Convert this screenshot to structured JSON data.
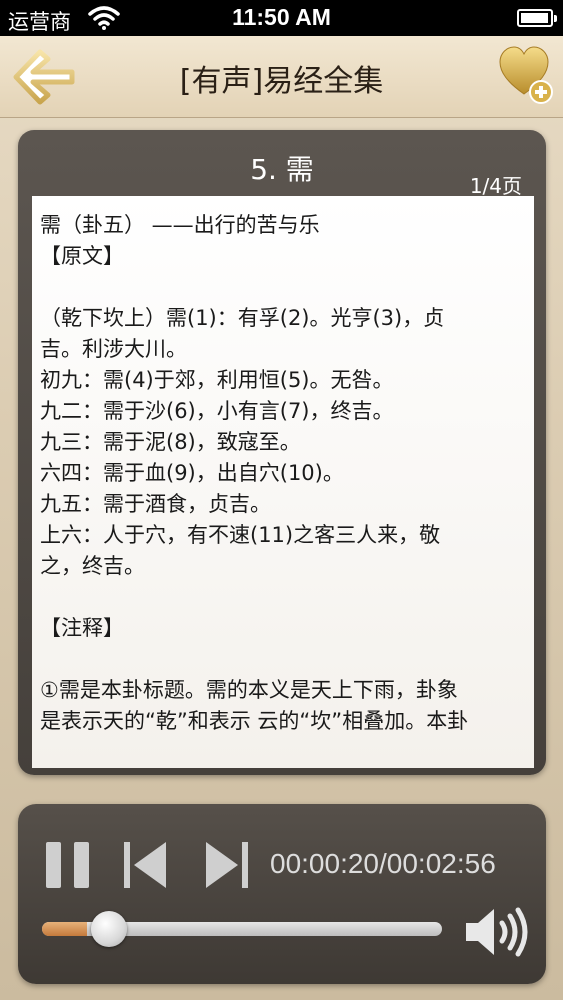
{
  "status_bar": {
    "carrier": "运营商",
    "time": "11:50 AM",
    "battery_level": 0.95
  },
  "nav": {
    "title": "[有声]易经全集",
    "back_icon": "arrow-left-icon",
    "favorite_icon": "heart-add-icon"
  },
  "reader": {
    "chapter_title": "5. 需",
    "page_indicator": "1/4页",
    "lines": [
      "需（卦五） ——出行的苦与乐",
      "【原文】",
      "",
      "（乾下坎上）需(1)：有孚(2)。光亨(3)，贞",
      "吉。利涉大川。",
      "初九：需(4)于郊，利用恒(5)。无咎。",
      "九二：需于沙(6)，小有言(7)，终吉。",
      "九三：需于泥(8)，致寇至。",
      "六四：需于血(9)，出自穴(10)。",
      "九五：需于酒食，贞吉。",
      "上六：人于穴，有不速(11)之客三人来，敬",
      "之，终吉。",
      "",
      "【注释】",
      "",
      "①需是本卦标题。需的本义是天上下雨，卦象",
      "是表示天的“乾”和表示 云的“坎”相叠加。本卦"
    ]
  },
  "player": {
    "time_display": "00:00:20/00:02:56",
    "progress": 0.1136,
    "pause_icon": "pause-icon",
    "prev_icon": "skip-previous-icon",
    "next_icon": "skip-next-icon",
    "volume_icon": "speaker-volume-icon",
    "accent_color": "#c47a3c"
  }
}
